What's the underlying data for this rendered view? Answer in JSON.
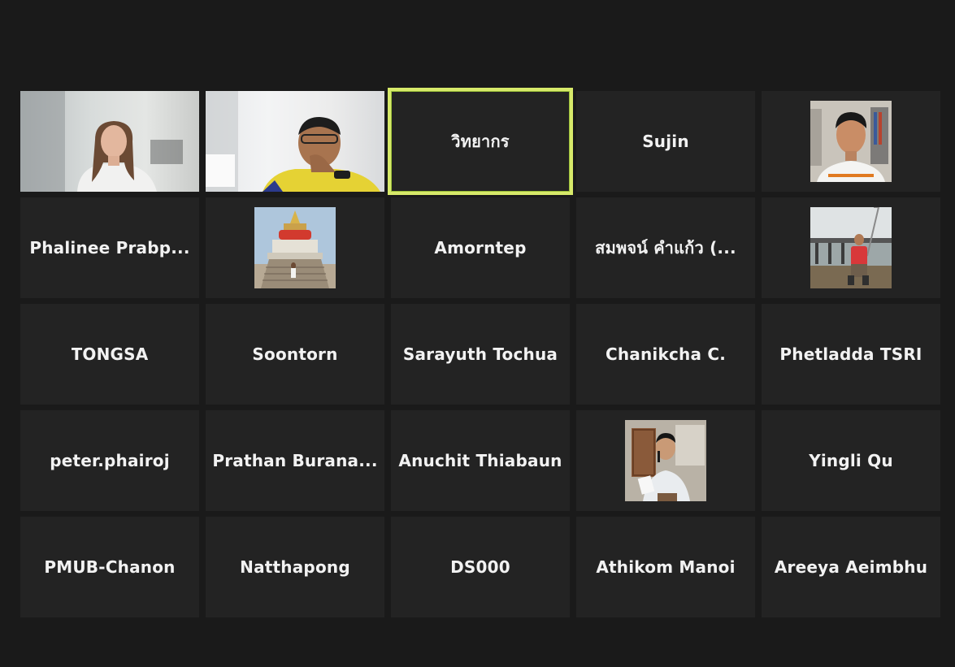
{
  "colors": {
    "background": "#1a1a1a",
    "tile": "#232323",
    "active_speaker_border": "#d7ea6a",
    "name_text": "#f2f2f2"
  },
  "participants": [
    {
      "name": "",
      "kind": "video",
      "icon": "person-video-feed"
    },
    {
      "name": "",
      "kind": "video",
      "icon": "person-video-feed"
    },
    {
      "name": "วิทยากร",
      "kind": "name",
      "active_speaker": true
    },
    {
      "name": "Sujin",
      "kind": "name"
    },
    {
      "name": "",
      "kind": "photo",
      "icon": "profile-photo-man"
    },
    {
      "name": "Phalinee   Prabp...",
      "kind": "name"
    },
    {
      "name": "",
      "kind": "photo",
      "icon": "profile-photo-temple"
    },
    {
      "name": "Amorntep",
      "kind": "name"
    },
    {
      "name": "สมพจน์ คำแก้ว (...",
      "kind": "name"
    },
    {
      "name": "",
      "kind": "photo",
      "icon": "profile-photo-riverside"
    },
    {
      "name": "TONGSA",
      "kind": "name"
    },
    {
      "name": "Soontorn",
      "kind": "name"
    },
    {
      "name": "Sarayuth Tochua",
      "kind": "name"
    },
    {
      "name": "Chanikcha C.",
      "kind": "name"
    },
    {
      "name": "Phetladda TSRI",
      "kind": "name"
    },
    {
      "name": "peter.phairoj",
      "kind": "name"
    },
    {
      "name": "Prathan  Burana...",
      "kind": "name"
    },
    {
      "name": "Anuchit Thiabaun",
      "kind": "name"
    },
    {
      "name": "",
      "kind": "photo",
      "icon": "profile-photo-speaker"
    },
    {
      "name": "Yingli Qu",
      "kind": "name"
    },
    {
      "name": "PMUB-Chanon",
      "kind": "name"
    },
    {
      "name": "Natthapong",
      "kind": "name"
    },
    {
      "name": "DS000",
      "kind": "name"
    },
    {
      "name": "Athikom Manoi",
      "kind": "name"
    },
    {
      "name": "Areeya Aeimbhu",
      "kind": "name"
    }
  ]
}
